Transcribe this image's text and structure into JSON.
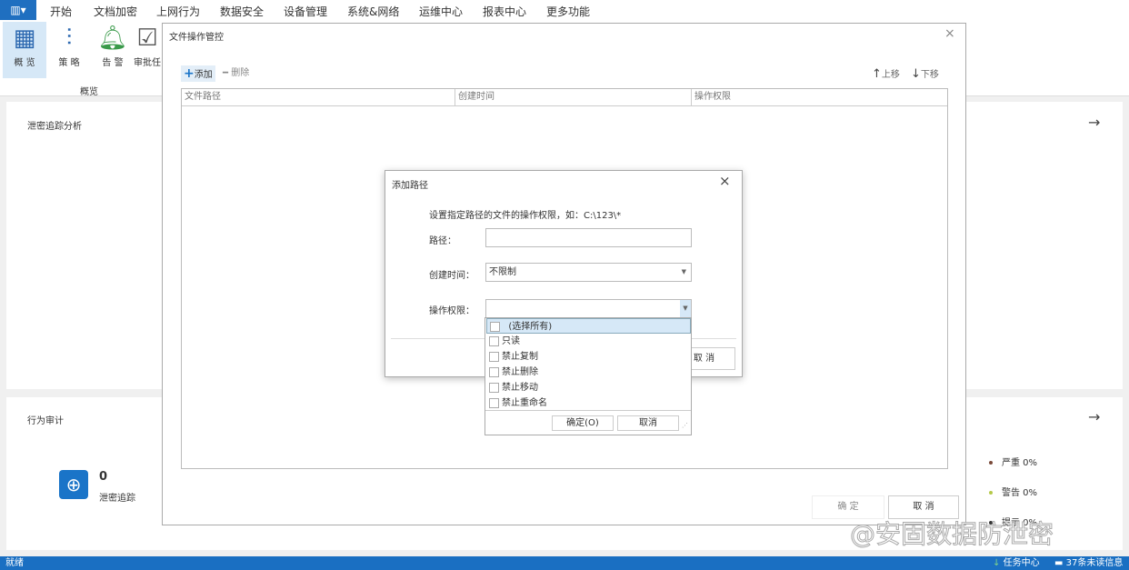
{
  "menu": {
    "items": [
      "开始",
      "文档加密",
      "上网行为",
      "数据安全",
      "设备管理",
      "系统&网络",
      "运维中心",
      "报表中心",
      "更多功能"
    ],
    "active": "数据安全"
  },
  "ribbon": {
    "buttons": [
      "概 览",
      "策 略",
      "告 警",
      "审批任"
    ],
    "group_label": "概览"
  },
  "panels": {
    "leak_trace": "泄密追踪分析",
    "behavior_audit": "行为审计"
  },
  "stat": {
    "value": "0",
    "label": "泄密追踪"
  },
  "legend": [
    {
      "label": "严重 0%",
      "color": "#7a4b3a"
    },
    {
      "label": "警告 0%",
      "color": "#b5c94a"
    },
    {
      "label": "提示 0%",
      "color": "#333333"
    }
  ],
  "file_dialog": {
    "title": "文件操作管控",
    "add": "添加",
    "delete": "删除",
    "move_up": "上移",
    "move_down": "下移",
    "columns": [
      "文件路径",
      "创建时间",
      "操作权限"
    ],
    "ok": "确 定",
    "cancel": "取 消"
  },
  "add_path": {
    "title": "添加路径",
    "hint": "设置指定路径的文件的操作权限，如：C:\\123\\*",
    "path_label": "路径：",
    "path_value": "",
    "time_label": "创建时间：",
    "time_value": "不限制",
    "perm_label": "操作权限：",
    "perm_value": "",
    "cancel": "取 消"
  },
  "dropdown": {
    "items": [
      "(选择所有)",
      "只读",
      "禁止复制",
      "禁止删除",
      "禁止移动",
      "禁止重命名"
    ],
    "ok": "确定(O)",
    "cancel": "取消"
  },
  "status": {
    "left": "就绪",
    "task_center": "任务中心",
    "unread": "37条未读信息"
  },
  "watermark": "@安固数据防泄密"
}
